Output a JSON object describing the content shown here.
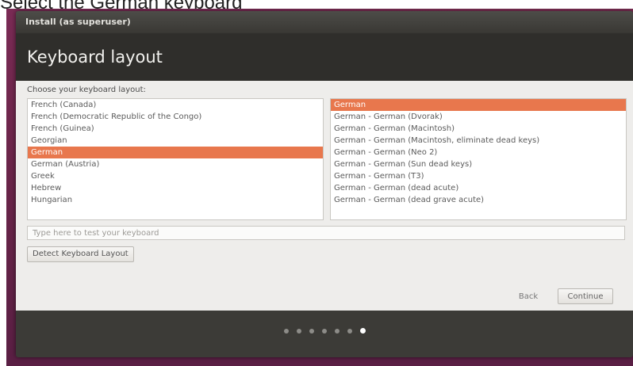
{
  "caption": "Select the German keyboard",
  "window": {
    "title": "Install (as superuser)",
    "heading": "Keyboard layout"
  },
  "content": {
    "prompt": "Choose your keyboard layout:",
    "layouts": [
      {
        "label": "French (Canada)",
        "selected": false
      },
      {
        "label": "French (Democratic Republic of the Congo)",
        "selected": false
      },
      {
        "label": "French (Guinea)",
        "selected": false
      },
      {
        "label": "Georgian",
        "selected": false
      },
      {
        "label": "German",
        "selected": true
      },
      {
        "label": "German (Austria)",
        "selected": false
      },
      {
        "label": "Greek",
        "selected": false
      },
      {
        "label": "Hebrew",
        "selected": false
      },
      {
        "label": "Hungarian",
        "selected": false
      }
    ],
    "variants": [
      {
        "label": "German",
        "selected": true
      },
      {
        "label": "German - German (Dvorak)",
        "selected": false
      },
      {
        "label": "German - German (Macintosh)",
        "selected": false
      },
      {
        "label": "German - German (Macintosh, eliminate dead keys)",
        "selected": false
      },
      {
        "label": "German - German (Neo 2)",
        "selected": false
      },
      {
        "label": "German - German (Sun dead keys)",
        "selected": false
      },
      {
        "label": "German - German (T3)",
        "selected": false
      },
      {
        "label": "German - German (dead acute)",
        "selected": false
      },
      {
        "label": "German - German (dead grave acute)",
        "selected": false
      }
    ],
    "test_placeholder": "Type here to test your keyboard",
    "detect_label": "Detect Keyboard Layout",
    "back_label": "Back",
    "continue_label": "Continue"
  },
  "progress": {
    "total_steps": 7,
    "current_step": 7
  },
  "colors": {
    "selection": "#e8774d",
    "window_bg": "#3c3b37",
    "content_bg": "#eeedeb"
  }
}
